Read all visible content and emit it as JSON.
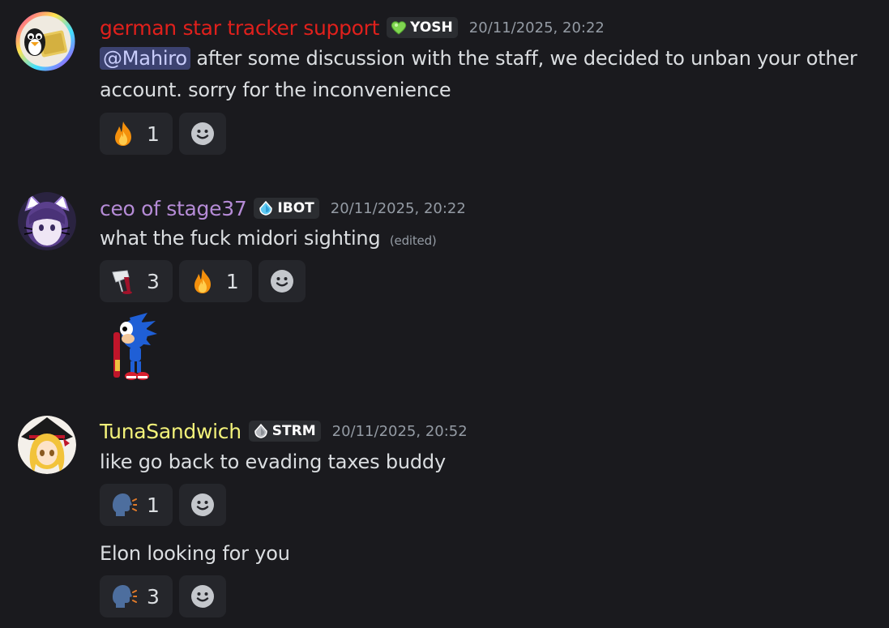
{
  "messages": [
    {
      "username": "german star tracker support",
      "username_color": "#e0201c",
      "tag": "YOSH",
      "tag_icon": "green-heart-icon",
      "timestamp": "20/11/2025, 20:22",
      "mention": "@Mahiro",
      "text": "after some discussion with the staff, we decided to unban your other",
      "text_line2": "account. sorry for the inconvenience",
      "reactions": [
        {
          "emoji": "fire-emoji",
          "count": "1"
        }
      ]
    },
    {
      "username": "ceo of stage37",
      "username_color": "#b58bd6",
      "tag": "IBOT",
      "tag_icon": "blue-drop-icon",
      "timestamp": "20/11/2025, 20:22",
      "text": "what the fuck midori sighting",
      "edited": "(edited)",
      "reactions": [
        {
          "emoji": "spilled-glass-emoji",
          "count": "3"
        },
        {
          "emoji": "fire-emoji",
          "count": "1"
        }
      ],
      "sticker": "sonic-sticker"
    },
    {
      "username": "TunaSandwich",
      "username_color": "#f3f27a",
      "tag": "STRM",
      "tag_icon": "gray-stone-icon",
      "timestamp": "20/11/2025, 20:52",
      "text": "like go back to evading taxes buddy",
      "reactions": [
        {
          "emoji": "speaking-head-emoji",
          "count": "1"
        }
      ],
      "followup_text": "Elon looking for you",
      "followup_reactions": [
        {
          "emoji": "speaking-head-emoji",
          "count": "3"
        }
      ]
    }
  ]
}
